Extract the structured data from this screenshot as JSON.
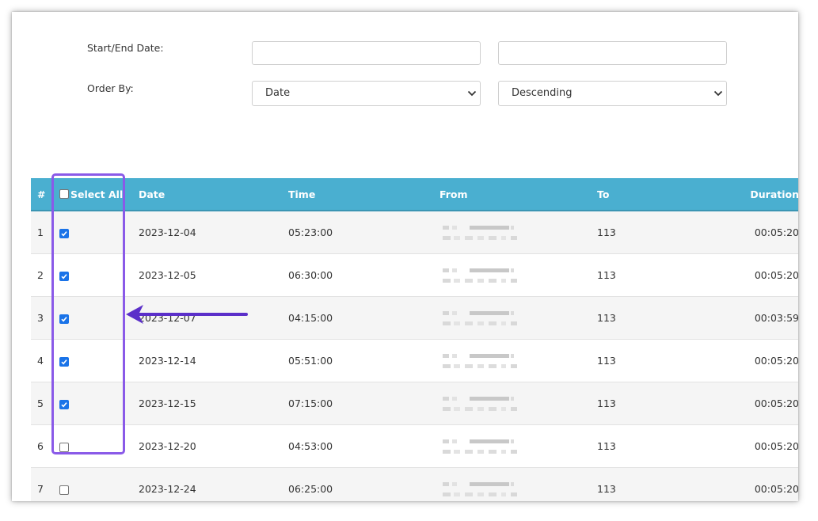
{
  "filters": {
    "date_label": "Start/End Date:",
    "start_date_value": "",
    "end_date_value": "",
    "order_label": "Order By:",
    "order_field_value": "Date",
    "order_direction_value": "Descending"
  },
  "table": {
    "headers": {
      "num": "#",
      "select_all": "Select All",
      "date": "Date",
      "time": "Time",
      "from": "From",
      "to": "To",
      "duration": "Duration"
    },
    "rows": [
      {
        "num": "1",
        "checked": true,
        "date": "2023-12-04",
        "time": "05:23:00",
        "to": "113",
        "duration": "00:05:20"
      },
      {
        "num": "2",
        "checked": true,
        "date": "2023-12-05",
        "time": "06:30:00",
        "to": "113",
        "duration": "00:05:20"
      },
      {
        "num": "3",
        "checked": true,
        "date": "2023-12-07",
        "time": "04:15:00",
        "to": "113",
        "duration": "00:03:59"
      },
      {
        "num": "4",
        "checked": true,
        "date": "2023-12-14",
        "time": "05:51:00",
        "to": "113",
        "duration": "00:05:20"
      },
      {
        "num": "5",
        "checked": true,
        "date": "2023-12-15",
        "time": "07:15:00",
        "to": "113",
        "duration": "00:05:20"
      },
      {
        "num": "6",
        "checked": false,
        "date": "2023-12-20",
        "time": "04:53:00",
        "to": "113",
        "duration": "00:05:20"
      },
      {
        "num": "7",
        "checked": false,
        "date": "2023-12-24",
        "time": "06:25:00",
        "to": "113",
        "duration": "00:05:20"
      }
    ]
  },
  "colors": {
    "header_bg": "#4aafd0",
    "highlight": "#8a5ae8",
    "arrow": "#5b2fc9",
    "checkbox_on": "#1a73e8"
  },
  "icons": {
    "select_chevron": "chevron-down-icon",
    "checkbox_check": "checkmark-icon"
  }
}
